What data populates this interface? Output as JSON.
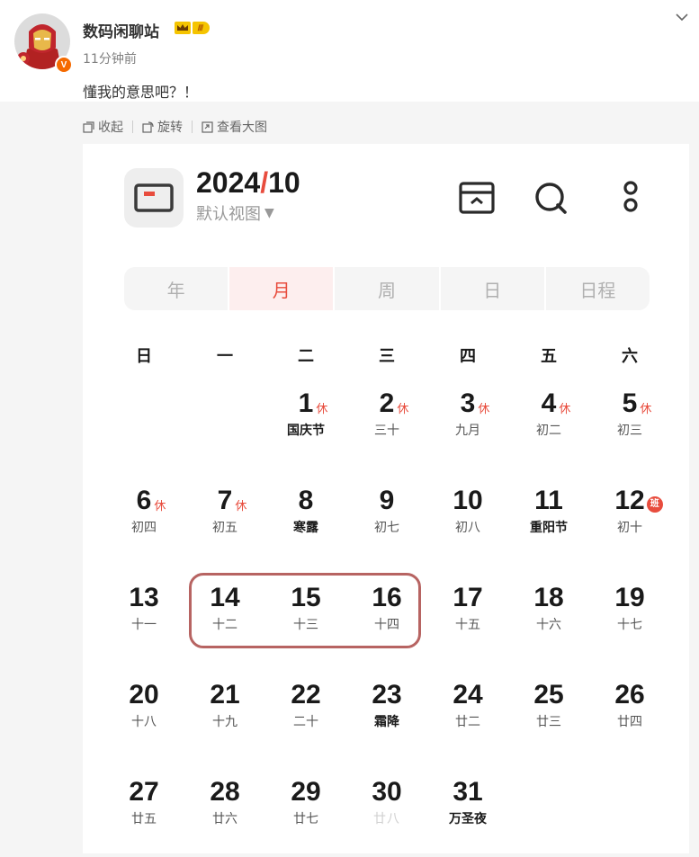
{
  "post": {
    "username": "数码闲聊站",
    "level_badge": "Ⅲ",
    "verified_mark": "V",
    "time": "11分钟前",
    "text": "懂我的意思吧？！"
  },
  "toolbar": {
    "collapse_label": "收起",
    "rotate_label": "旋转",
    "view_large_label": "查看大图"
  },
  "calendar": {
    "year": "2024",
    "slash": "/",
    "month": "10",
    "view_label": "默认视图",
    "view_arrow": "▼",
    "tabs": [
      {
        "label": "年",
        "active": false
      },
      {
        "label": "月",
        "active": true
      },
      {
        "label": "周",
        "active": false
      },
      {
        "label": "日",
        "active": false
      },
      {
        "label": "日程",
        "active": false
      }
    ],
    "weekdays": [
      "日",
      "一",
      "二",
      "三",
      "四",
      "五",
      "六"
    ],
    "weeks": [
      [
        null,
        null,
        {
          "num": "1",
          "tag": "休",
          "sub": "国庆节",
          "fest": true
        },
        {
          "num": "2",
          "tag": "休",
          "sub": "三十"
        },
        {
          "num": "3",
          "tag": "休",
          "sub": "九月"
        },
        {
          "num": "4",
          "tag": "休",
          "sub": "初二"
        },
        {
          "num": "5",
          "tag": "休",
          "sub": "初三"
        }
      ],
      [
        {
          "num": "6",
          "tag": "休",
          "sub": "初四"
        },
        {
          "num": "7",
          "tag": "休",
          "sub": "初五"
        },
        {
          "num": "8",
          "sub": "寒露",
          "fest": true
        },
        {
          "num": "9",
          "sub": "初七"
        },
        {
          "num": "10",
          "sub": "初八"
        },
        {
          "num": "11",
          "sub": "重阳节",
          "fest": true
        },
        {
          "num": "12",
          "work": "班",
          "sub": "初十"
        }
      ],
      [
        {
          "num": "13",
          "sub": "十一"
        },
        {
          "num": "14",
          "sub": "十二"
        },
        {
          "num": "15",
          "sub": "十三"
        },
        {
          "num": "16",
          "sub": "十四"
        },
        {
          "num": "17",
          "sub": "十五"
        },
        {
          "num": "18",
          "sub": "十六"
        },
        {
          "num": "19",
          "sub": "十七"
        }
      ],
      [
        {
          "num": "20",
          "sub": "十八"
        },
        {
          "num": "21",
          "sub": "十九"
        },
        {
          "num": "22",
          "sub": "二十"
        },
        {
          "num": "23",
          "sub": "霜降",
          "fest": true
        },
        {
          "num": "24",
          "sub": "廿二"
        },
        {
          "num": "25",
          "sub": "廿三"
        },
        {
          "num": "26",
          "sub": "廿四"
        }
      ],
      [
        {
          "num": "27",
          "sub": "廿五"
        },
        {
          "num": "28",
          "sub": "廿六"
        },
        {
          "num": "29",
          "sub": "廿七"
        },
        {
          "num": "30",
          "sub": "廿八",
          "faded": true
        },
        {
          "num": "31",
          "sub": "万圣夜",
          "fest": true
        },
        null,
        null
      ]
    ],
    "today": "1",
    "highlighted_dates": [
      "14",
      "15",
      "16"
    ],
    "colors": {
      "accent": "#e84c3d",
      "highlight_border": "#b76462",
      "active_tab_bg": "#fdeeee"
    }
  }
}
